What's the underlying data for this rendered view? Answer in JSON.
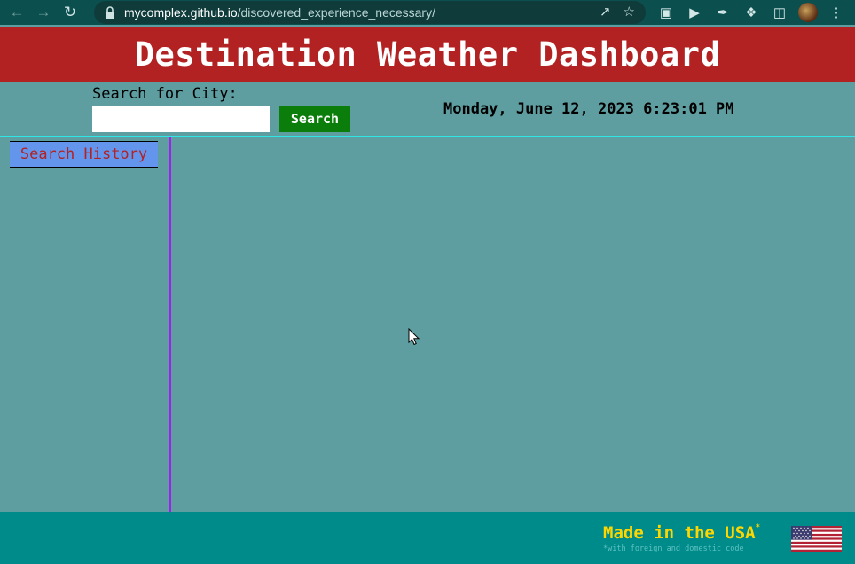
{
  "browser": {
    "url_host": "mycomplex.github.io",
    "url_path": "/discovered_experience_necessary/"
  },
  "header": {
    "title": "Destination Weather Dashboard"
  },
  "search": {
    "label": "Search for City:",
    "input_value": "",
    "button_label": "Search"
  },
  "clock": {
    "datetime": "Monday, June 12, 2023 6:23:01 PM"
  },
  "sidebar": {
    "heading": "Search History",
    "items": []
  },
  "footer": {
    "made_in": "Made in the USA",
    "made_in_mark": "*",
    "made_in_note": "*with foreign and domestic code"
  },
  "colors": {
    "header_bg": "#b22222",
    "page_bg": "#5f9ea0",
    "search_button_bg": "#0a7d0a",
    "history_heading_bg": "#6495ed",
    "sidebar_divider": "#a020f0",
    "footer_bg": "#008b8b",
    "footer_text": "#ffd700"
  },
  "icons": {
    "back": "back-arrow-icon",
    "forward": "forward-arrow-icon",
    "reload": "reload-icon",
    "lock": "lock-icon",
    "share": "share-icon",
    "bookmark": "star-icon",
    "extensions": "puzzle-icon",
    "menu": "kebab-menu-icon"
  }
}
